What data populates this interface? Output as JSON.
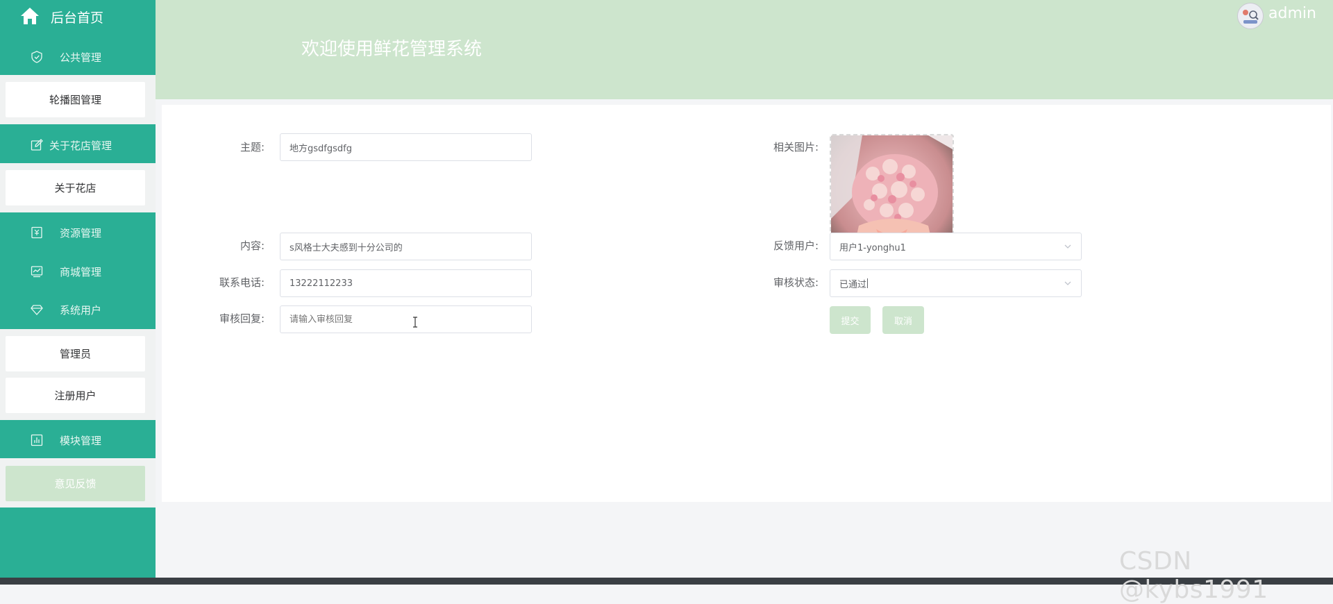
{
  "sidebar": {
    "home_label": "后台首页",
    "groups": [
      {
        "label": "公共管理",
        "icon": "shield-icon"
      },
      {
        "label": "关于花店管理",
        "icon": "edit-icon"
      },
      {
        "label": "资源管理",
        "icon": "document-icon"
      },
      {
        "label": "商城管理",
        "icon": "chart-icon"
      },
      {
        "label": "系统用户",
        "icon": "diamond-icon"
      },
      {
        "label": "模块管理",
        "icon": "bar-chart-icon"
      }
    ],
    "items": {
      "carousel": "轮播图管理",
      "about_shop": "关于花店",
      "admin": "管理员",
      "registered_users": "注册用户",
      "feedback": "意见反馈"
    }
  },
  "header": {
    "title": "欢迎使用鲜花管理系统",
    "username": "admin"
  },
  "form": {
    "subject_label": "主题:",
    "subject_value": "地方gsdfgsdfg",
    "image_label": "相关图片:",
    "content_label": "内容:",
    "content_value": "s风格士大夫感到十分公司的",
    "feedback_user_label": "反馈用户:",
    "feedback_user_value": "用户1-yonghu1",
    "phone_label": "联系电话:",
    "phone_value": "13222112233",
    "review_status_label": "审核状态:",
    "review_status_value": "已通过",
    "review_reply_label": "审核回复:",
    "review_reply_placeholder": "请输入审核回复",
    "submit_label": "提交",
    "cancel_label": "取消"
  },
  "watermark": "CSDN @kybs1991",
  "colors": {
    "sidebar": "#2aaf95",
    "header": "#cde5cd",
    "accent_light": "#cde5cd"
  }
}
